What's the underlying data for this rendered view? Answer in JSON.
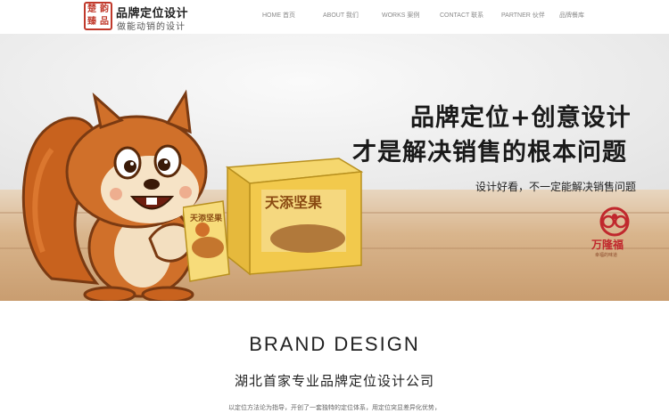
{
  "header": {
    "logo_seal_chars": [
      "楚",
      "韵",
      "臻",
      "品"
    ],
    "logo_title": "品牌定位设计",
    "logo_subtitle": "做能动销的设计"
  },
  "nav": {
    "items": [
      {
        "label": "HOME 首页"
      },
      {
        "label": "ABOUT 我们"
      },
      {
        "label": "WORKS 案例"
      },
      {
        "label": "CONTACT 联系"
      },
      {
        "label": "PARTNER 伙伴"
      },
      {
        "label": "品牌餐库"
      }
    ]
  },
  "banner": {
    "headline_1": "品牌定位+创意设计",
    "headline_2": "才是解决销售的根本问题",
    "tagline": "设计好看，不一定能解决销售问题",
    "product_name": "天添坚果",
    "brand_name": "万隆福",
    "brand_slogan": "幸福的味道"
  },
  "content": {
    "section_title": "BRAND DESIGN",
    "company": "湖北首家专业品牌定位设计公司",
    "description": "以定位方法论为指导，开创了一套独特的定位体系，用定位突显差异化优势，"
  },
  "colors": {
    "accent": "#c0392b",
    "text_dark": "#1a1a1a",
    "nav_text": "#8a8a8a"
  }
}
